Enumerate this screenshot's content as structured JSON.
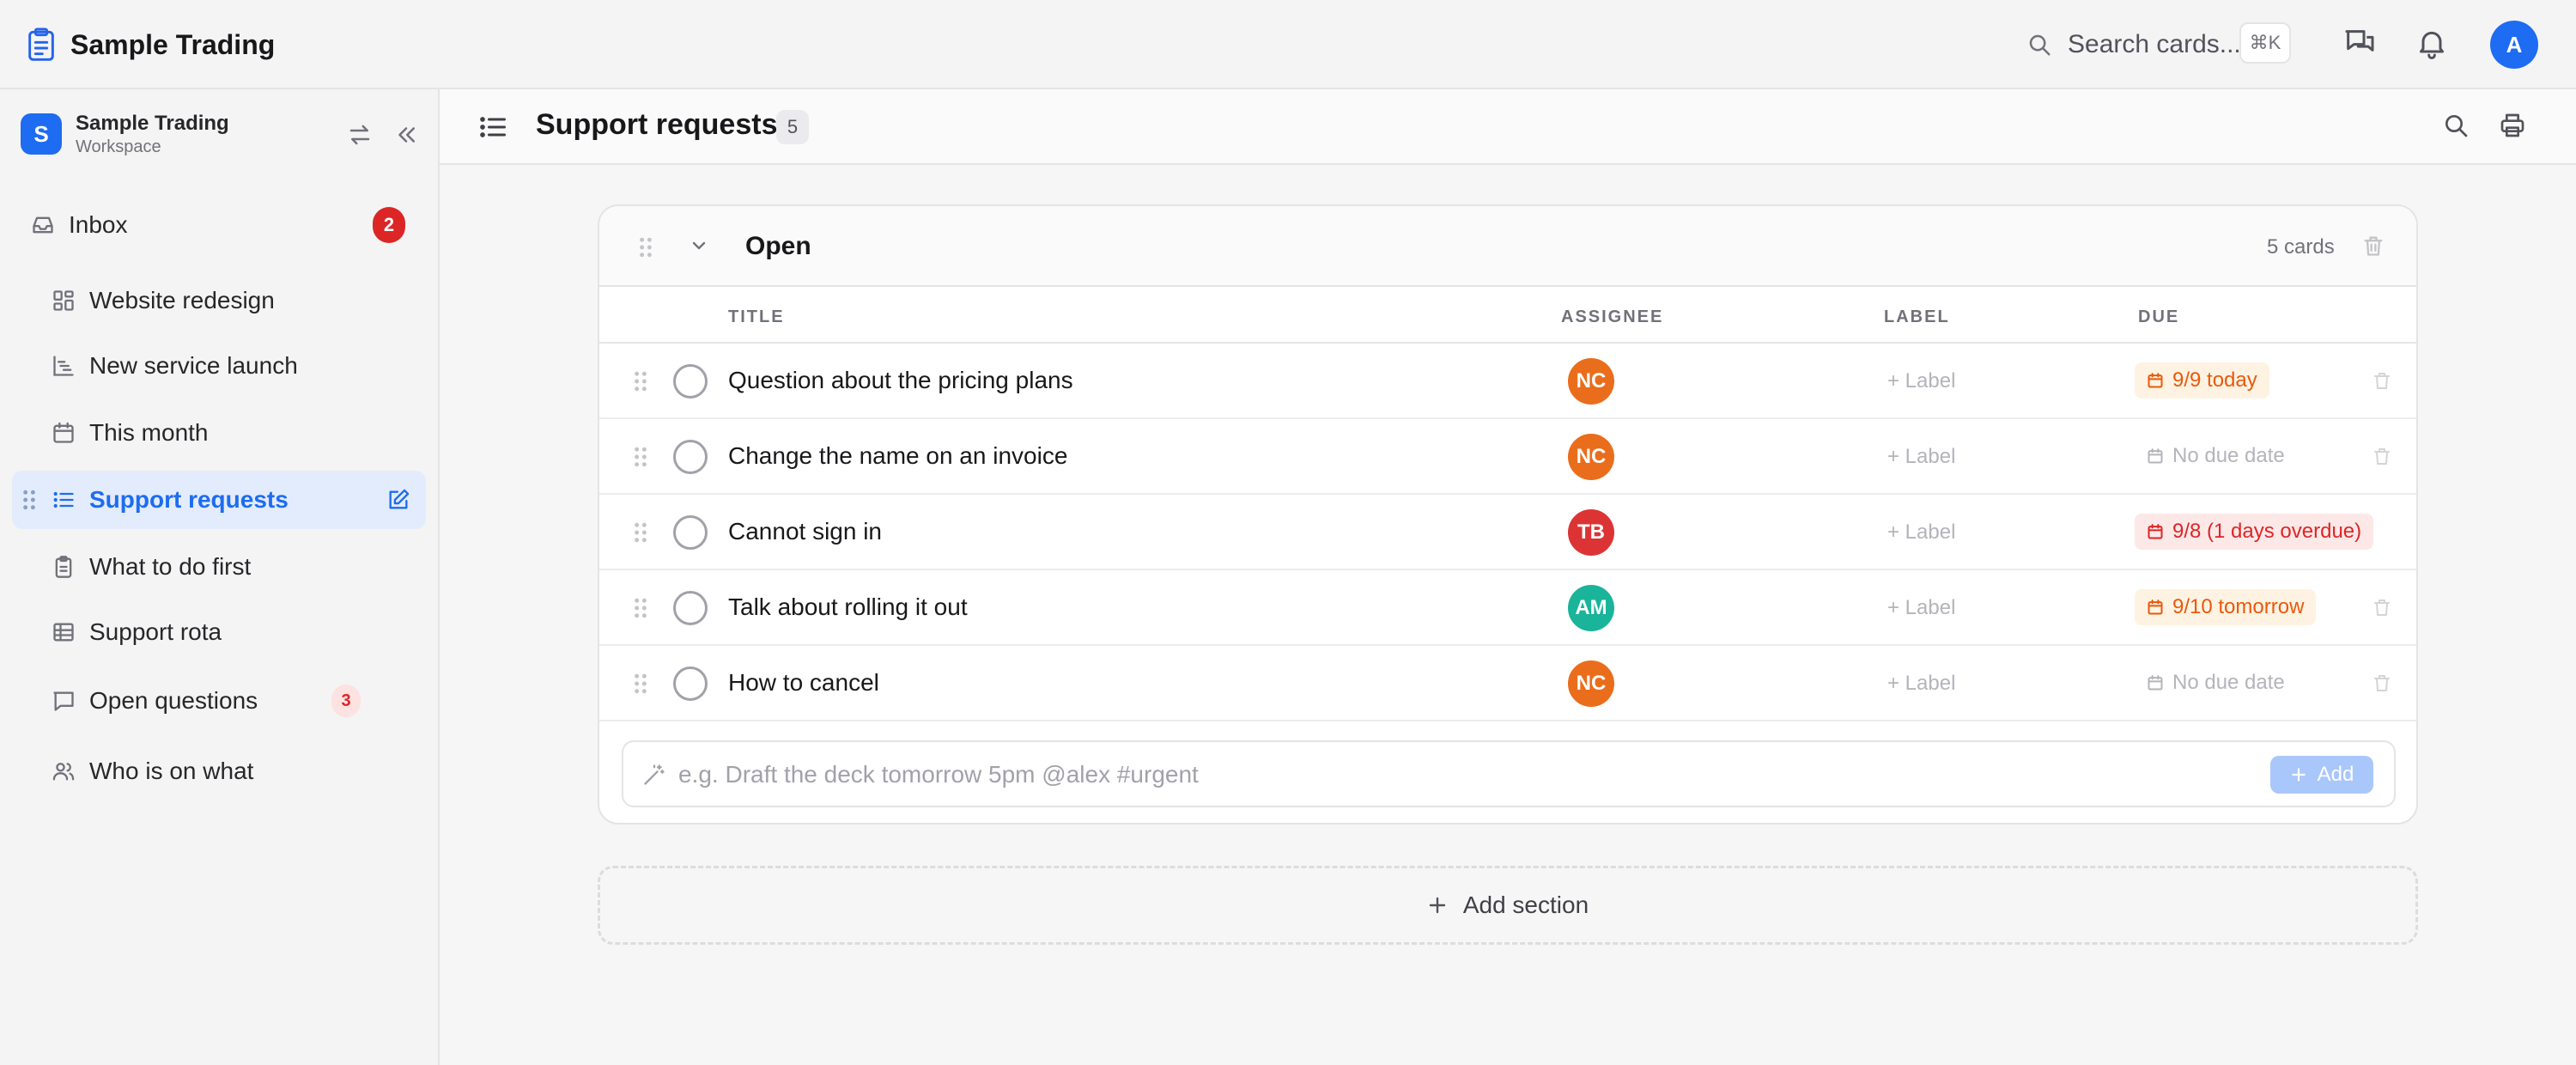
{
  "app": {
    "name": "Sample Trading"
  },
  "topbar": {
    "search_label": "Search cards...",
    "search_shortcut": "⌘K",
    "avatar_initial": "A"
  },
  "workspace": {
    "badge": "S",
    "name": "Sample Trading",
    "subtitle": "Workspace"
  },
  "sidebar": {
    "items": [
      {
        "label": "Inbox",
        "icon": "inbox-icon",
        "count": "2"
      },
      {
        "label": "Website redesign",
        "icon": "board-icon"
      },
      {
        "label": "New service launch",
        "icon": "timeline-icon"
      },
      {
        "label": "This month",
        "icon": "calendar-icon"
      },
      {
        "label": "Support requests",
        "icon": "list-icon",
        "active": true
      },
      {
        "label": "What to do first",
        "icon": "clipboard-icon"
      },
      {
        "label": "Support rota",
        "icon": "table-icon"
      },
      {
        "label": "Open questions",
        "icon": "chat-icon",
        "count": "3"
      },
      {
        "label": "Who is on what",
        "icon": "users-icon"
      }
    ]
  },
  "page": {
    "title": "Support requests",
    "count": "5"
  },
  "section": {
    "title": "Open",
    "card_count": "5 cards",
    "columns": {
      "title": "TITLE",
      "assignee": "ASSIGNEE",
      "label": "LABEL",
      "due": "DUE"
    },
    "rows": [
      {
        "title": "Question about the pricing plans",
        "assignee": "NC",
        "assignee_color": "#ea6d1c",
        "label": "+ Label",
        "due": "9/9 today",
        "due_status": "today"
      },
      {
        "title": "Change the name on an invoice",
        "assignee": "NC",
        "assignee_color": "#ea6d1c",
        "label": "+ Label",
        "due": "No due date",
        "due_status": "none"
      },
      {
        "title": "Cannot sign in",
        "assignee": "TB",
        "assignee_color": "#dc3434",
        "label": "+ Label",
        "due": "9/8 (1 days overdue)",
        "due_status": "overdue"
      },
      {
        "title": "Talk about rolling it out",
        "assignee": "AM",
        "assignee_color": "#19b49a",
        "label": "+ Label",
        "due": "9/10 tomorrow",
        "due_status": "tomorrow"
      },
      {
        "title": "How to cancel",
        "assignee": "NC",
        "assignee_color": "#ea6d1c",
        "label": "+ Label",
        "due": "No due date",
        "due_status": "none"
      }
    ],
    "quick_add": {
      "placeholder": "e.g. Draft the deck tomorrow 5pm @alex #urgent",
      "button": "Add"
    }
  },
  "add_section": {
    "label": "Add section"
  },
  "colors": {
    "accent": "#1d6cf2",
    "badge_red": "#dc2626",
    "due_orange": "#ea580c"
  }
}
